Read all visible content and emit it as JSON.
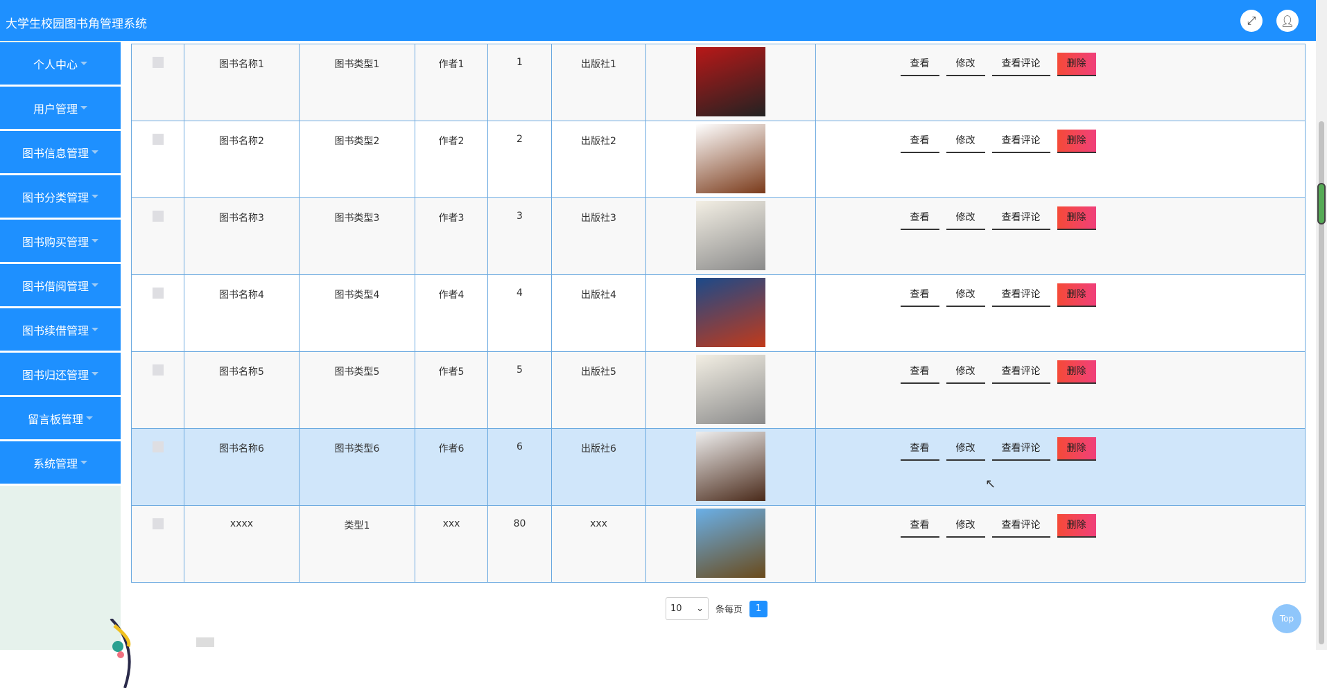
{
  "header": {
    "title": "大学生校园图书角管理系统",
    "fullscreen_icon": "expand-icon",
    "user_icon": "user-icon"
  },
  "sidebar": {
    "items": [
      {
        "label": "个人中心"
      },
      {
        "label": "用户管理"
      },
      {
        "label": "图书信息管理"
      },
      {
        "label": "图书分类管理"
      },
      {
        "label": "图书购买管理"
      },
      {
        "label": "图书借阅管理"
      },
      {
        "label": "图书续借管理"
      },
      {
        "label": "图书归还管理"
      },
      {
        "label": "留言板管理"
      },
      {
        "label": "系统管理"
      }
    ]
  },
  "table": {
    "rows": [
      {
        "name": "图书名称1",
        "type": "图书类型1",
        "author": "作者1",
        "count": "1",
        "publisher": "出版社1",
        "cover": [
          "#b81818",
          "#222"
        ]
      },
      {
        "name": "图书名称2",
        "type": "图书类型2",
        "author": "作者2",
        "count": "2",
        "publisher": "出版社2",
        "cover": [
          "#fff",
          "#7a3a1a"
        ]
      },
      {
        "name": "图书名称3",
        "type": "图书类型3",
        "author": "作者3",
        "count": "3",
        "publisher": "出版社3",
        "cover": [
          "#f3efe4",
          "#8a8a8a"
        ]
      },
      {
        "name": "图书名称4",
        "type": "图书类型4",
        "author": "作者4",
        "count": "4",
        "publisher": "出版社4",
        "cover": [
          "#1b4a8a",
          "#c23a1a"
        ]
      },
      {
        "name": "图书名称5",
        "type": "图书类型5",
        "author": "作者5",
        "count": "5",
        "publisher": "出版社5",
        "cover": [
          "#f3efe4",
          "#8a8a8a"
        ]
      },
      {
        "name": "图书名称6",
        "type": "图书类型6",
        "author": "作者6",
        "count": "6",
        "publisher": "出版社6",
        "cover": [
          "#eee",
          "#4a2a1a"
        ]
      },
      {
        "name": "xxxx",
        "type": "类型1",
        "author": "xxx",
        "count": "80",
        "publisher": "xxx",
        "cover": [
          "#6ab0e8",
          "#6a4a1a"
        ]
      }
    ],
    "actions": {
      "view": "查看",
      "edit": "修改",
      "comments": "查看评论",
      "delete": "删除"
    }
  },
  "pagination": {
    "page_size": "10",
    "per_page_label": "条每页",
    "current_page": "1"
  },
  "back_to_top": "Top",
  "colors": {
    "primary": "#1E90FF",
    "delete": "#f54a38",
    "hover_row": "#d0e6fa"
  }
}
